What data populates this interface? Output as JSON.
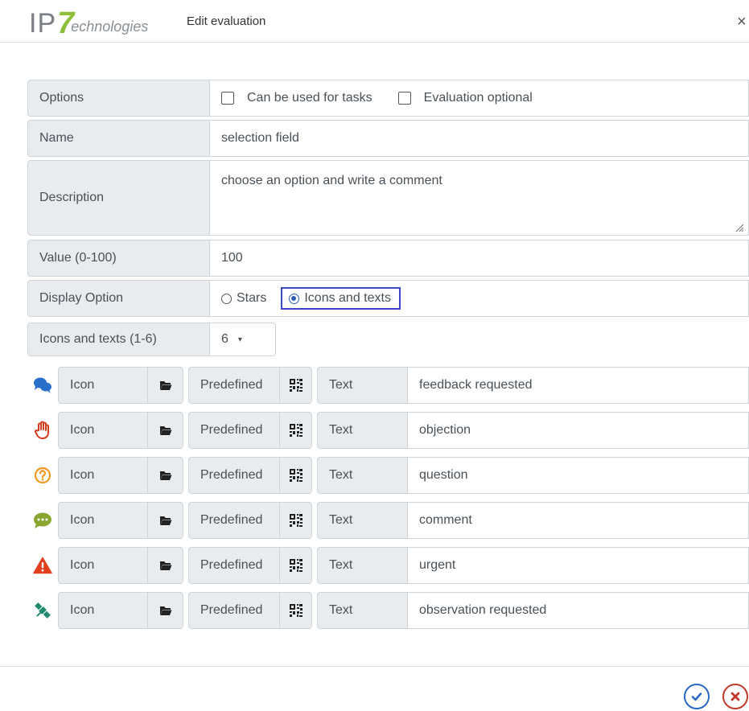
{
  "header": {
    "logo_ip": "IP",
    "logo_seven": "7",
    "logo_tech": "echnologies",
    "title": "Edit evaluation",
    "close_symbol": "×"
  },
  "form": {
    "options": {
      "label": "Options",
      "checkbox1": "Can be used for tasks",
      "checkbox1_checked": false,
      "checkbox2": "Evaluation optional",
      "checkbox2_checked": false
    },
    "name": {
      "label": "Name",
      "value": "selection field"
    },
    "description": {
      "label": "Description",
      "value": "choose an option and write a comment"
    },
    "value": {
      "label": "Value (0-100)",
      "value": "100"
    },
    "display_option": {
      "label": "Display Option",
      "options": [
        "Stars",
        "Icons and texts"
      ],
      "selected": "Icons and texts"
    },
    "icons_count": {
      "label": "Icons and texts (1-6)",
      "selected": "6",
      "caret": "▾"
    }
  },
  "icon_rows": [
    {
      "icon": "speech-bubbles-icon",
      "color": "#2a6fc9",
      "icon_label": "Icon",
      "predefined_label": "Predefined",
      "text_label": "Text",
      "text": "feedback requested"
    },
    {
      "icon": "raised-hand-icon",
      "color": "#d63b1f",
      "icon_label": "Icon",
      "predefined_label": "Predefined",
      "text_label": "Text",
      "text": "objection"
    },
    {
      "icon": "question-circle-icon",
      "color": "#f29a1f",
      "icon_label": "Icon",
      "predefined_label": "Predefined",
      "text_label": "Text",
      "text": "question"
    },
    {
      "icon": "comment-dots-icon",
      "color": "#8aa62f",
      "icon_label": "Icon",
      "predefined_label": "Predefined",
      "text_label": "Text",
      "text": "comment"
    },
    {
      "icon": "warning-triangle-icon",
      "color": "#e2401c",
      "icon_label": "Icon",
      "predefined_label": "Predefined",
      "text_label": "Text",
      "text": "urgent"
    },
    {
      "icon": "satellite-icon",
      "color": "#1f8a6e",
      "icon_label": "Icon",
      "predefined_label": "Predefined",
      "text_label": "Text",
      "text": "observation requested"
    }
  ],
  "colors": {
    "accent": "#3d47c9",
    "ok": "#2a67c7",
    "cancel": "#c0392b",
    "label_bg": "#e9ecef",
    "border": "#ced4da"
  }
}
